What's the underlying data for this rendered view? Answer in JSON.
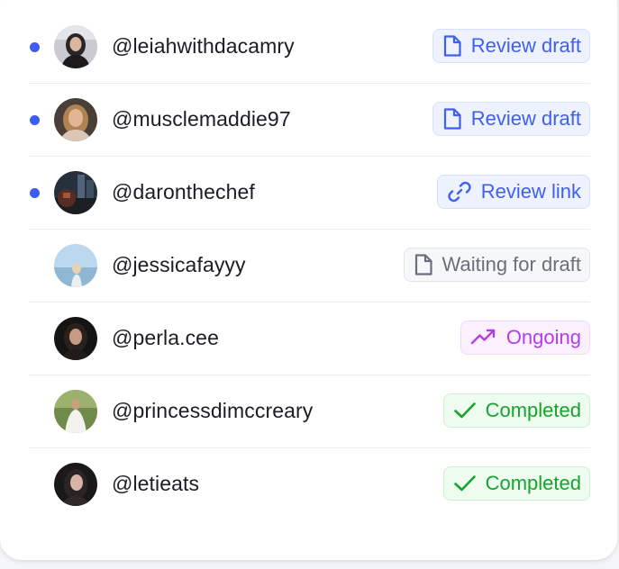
{
  "rows": [
    {
      "handle": "@leiahwithdacamry",
      "unread": true,
      "status": {
        "label": "Review draft",
        "icon": "document-icon",
        "color": "#3f5ff0"
      }
    },
    {
      "handle": "@musclemaddie97",
      "unread": true,
      "status": {
        "label": "Review draft",
        "icon": "document-icon",
        "color": "#3f5ff0"
      }
    },
    {
      "handle": "@daronthechef",
      "unread": true,
      "status": {
        "label": "Review link",
        "icon": "link-icon",
        "color": "#3f5ff0"
      }
    },
    {
      "handle": "@jessicafayyy",
      "unread": false,
      "status": {
        "label": "Waiting for draft",
        "icon": "document-icon",
        "color": "#6a6f7b"
      }
    },
    {
      "handle": "@perla.cee",
      "unread": false,
      "status": {
        "label": "Ongoing",
        "icon": "trending-up-icon",
        "color": "#b13fe8"
      }
    },
    {
      "handle": "@princessdimccreary",
      "unread": false,
      "status": {
        "label": "Completed",
        "icon": "check-icon",
        "color": "#17a32e"
      }
    },
    {
      "handle": "@letieats",
      "unread": false,
      "status": {
        "label": "Completed",
        "icon": "check-icon",
        "color": "#17a32e"
      }
    }
  ]
}
